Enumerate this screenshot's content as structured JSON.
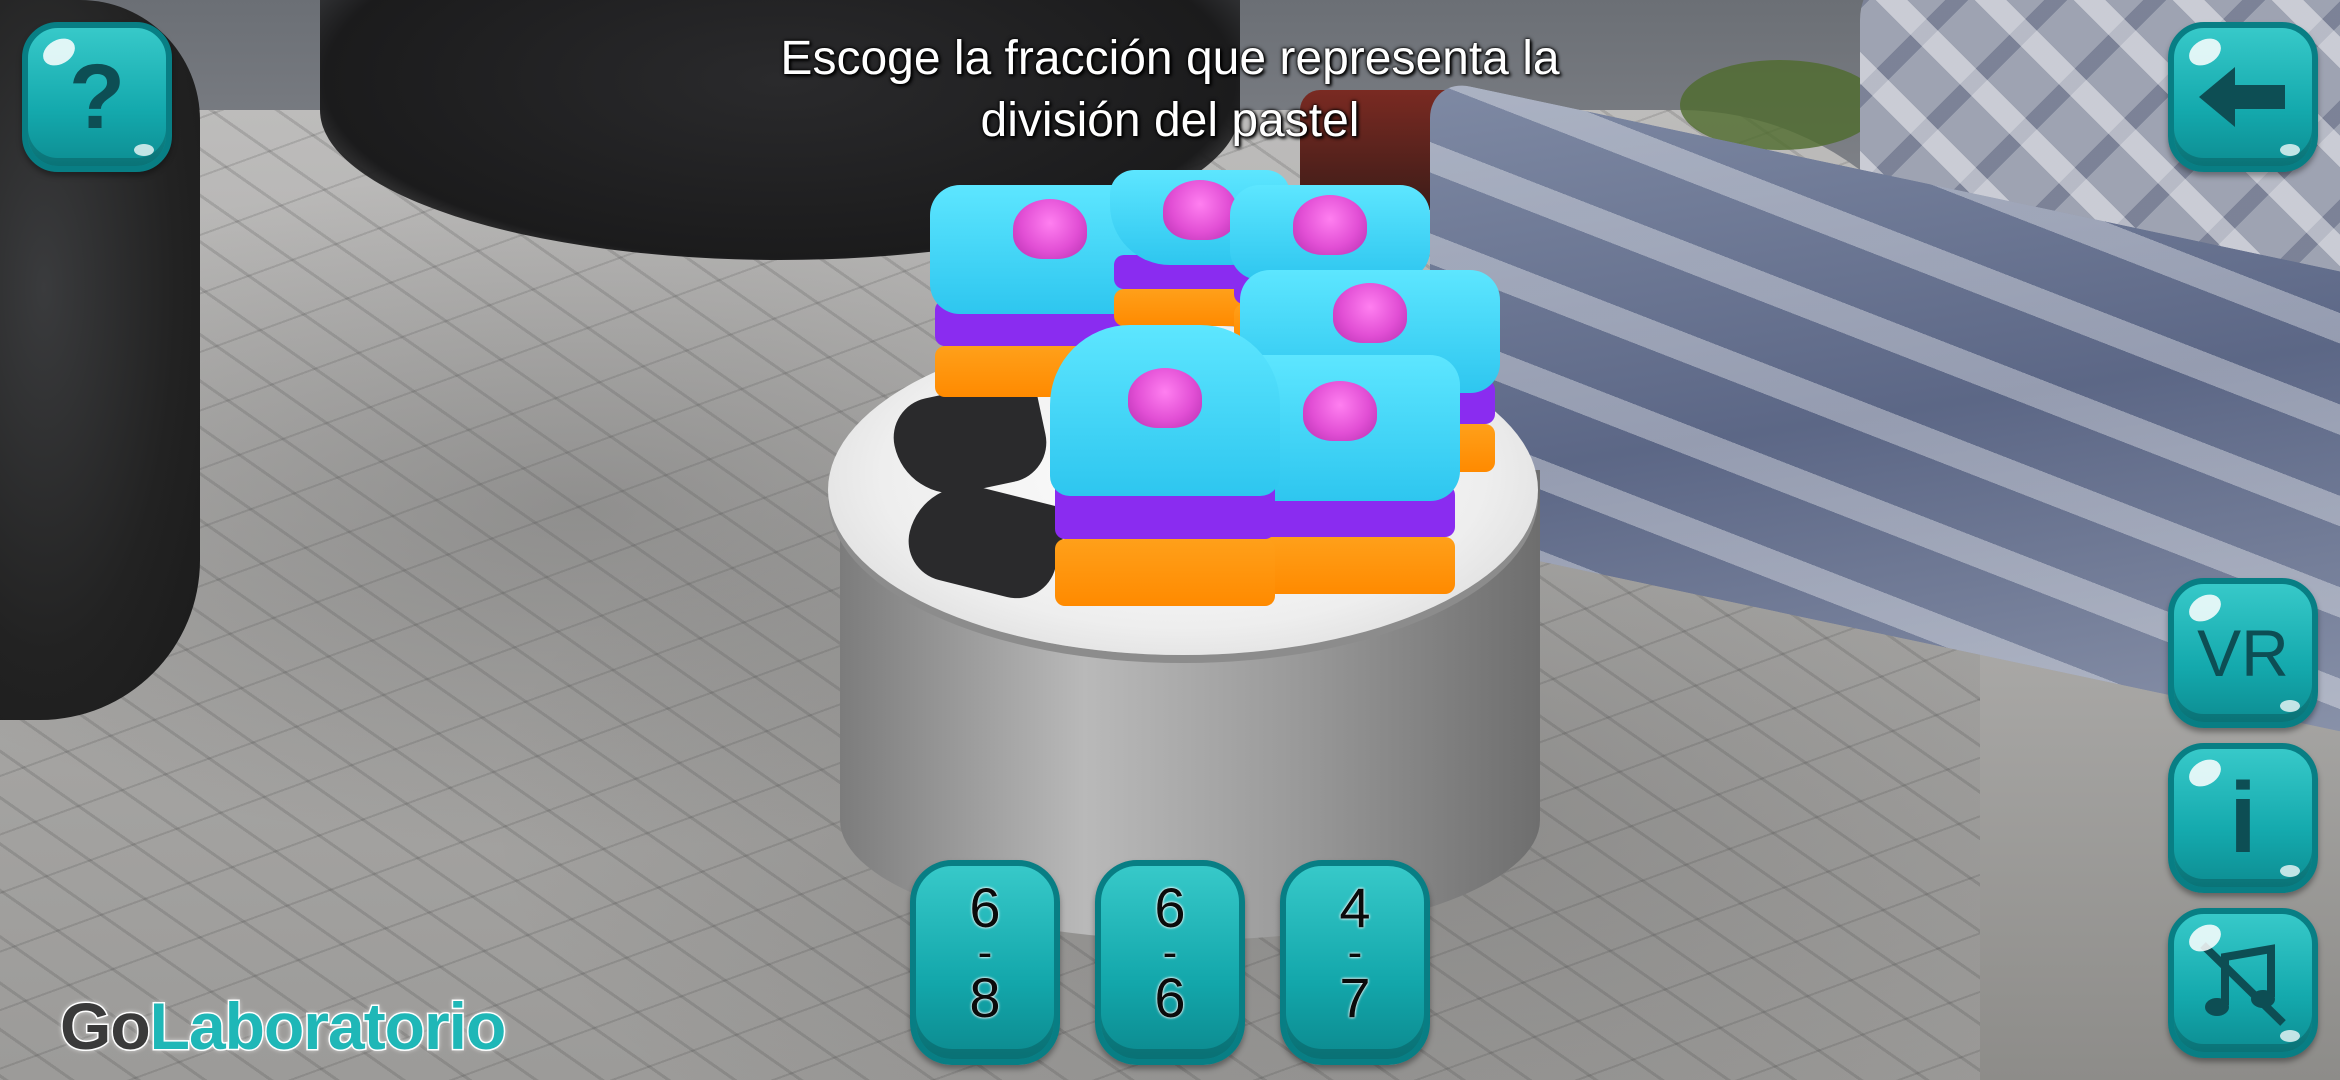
{
  "title": "Escoge la fracción que representa la\ndivisión del pastel",
  "buttons": {
    "help": "?",
    "back": "back-arrow-icon",
    "vr": "VR",
    "info": "i",
    "sound": "sound-off-icon"
  },
  "answers": [
    {
      "numerator": "6",
      "bar": "-",
      "denominator": "8"
    },
    {
      "numerator": "6",
      "bar": "-",
      "denominator": "6"
    },
    {
      "numerator": "4",
      "bar": "-",
      "denominator": "7"
    }
  ],
  "logo": {
    "part1": "Go",
    "part2": "Laboratorio"
  },
  "colors": {
    "button": "#14a9ad",
    "button_border": "#087e84",
    "frosting": "#2ec6ef",
    "cream": "#8a2cf0",
    "sponge": "#ff8a00",
    "swirl": "#e24fd5"
  }
}
